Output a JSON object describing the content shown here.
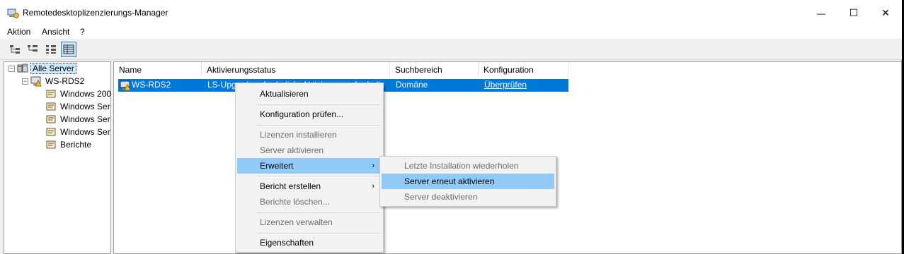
{
  "window": {
    "title": "Remotedesktoplizenzierungs-Manager"
  },
  "title_buttons": {
    "minimize": "—",
    "maximize": "☐",
    "close": "✕"
  },
  "menubar": {
    "items": [
      "Aktion",
      "Ansicht",
      "?"
    ]
  },
  "toolbar": {
    "buttons": [
      "tree-view-icon",
      "expand-view-icon",
      "details-view-icon",
      "list-view-icon"
    ]
  },
  "tree": {
    "root": {
      "label": "Alle Server",
      "toggle": "−"
    },
    "server": {
      "label": "WS-RDS2",
      "toggle": "−"
    },
    "children": [
      "Windows 200",
      "Windows Ser",
      "Windows Ser",
      "Windows Ser",
      "Berichte"
    ]
  },
  "list": {
    "columns": [
      "Name",
      "Aktivierungsstatus",
      "Suchbereich",
      "Konfiguration"
    ],
    "rows": [
      {
        "name": "WS-RDS2",
        "status": "LS-Upgrade erforderlich, Aktivierung erforderlich",
        "scope": "Domäne",
        "config": "Überprüfen"
      }
    ]
  },
  "context_menu": {
    "refresh": "Aktualisieren",
    "check_config": "Konfiguration prüfen...",
    "install_licenses": "Lizenzen installieren",
    "activate_server": "Server aktivieren",
    "advanced": "Erweitert",
    "create_report": "Bericht erstellen",
    "delete_reports": "Berichte löschen...",
    "manage_licenses": "Lizenzen verwalten",
    "properties": "Eigenschaften",
    "submenu_arrow": "›"
  },
  "submenu": {
    "repeat_install": "Letzte Installation wiederholen",
    "reactivate": "Server erneut aktivieren",
    "deactivate": "Server deaktivieren"
  },
  "colors": {
    "selection": "#0078d7",
    "menu_highlight": "#91c9f7"
  }
}
